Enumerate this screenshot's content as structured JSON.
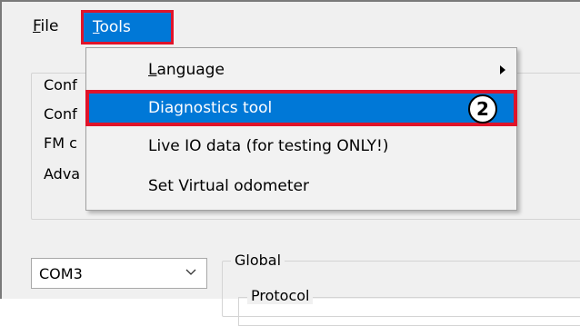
{
  "menubar": {
    "file": {
      "mnemonic": "F",
      "rest": "ile"
    },
    "tools": {
      "mnemonic": "T",
      "rest": "ools"
    }
  },
  "background": {
    "labels": [
      "Conf",
      "Conf",
      "FM c",
      "Adva"
    ],
    "com_port": "COM3",
    "global_label": "Global",
    "protocol_label": "Protocol"
  },
  "tools_menu": {
    "items": [
      {
        "mnemonic": "L",
        "rest": "anguage",
        "has_submenu": true
      },
      {
        "label": "Diagnostics tool",
        "selected": true
      },
      {
        "label": "Live IO data (for testing ONLY!)"
      },
      {
        "label": "Set Virtual odometer"
      }
    ],
    "step_badge": "2"
  },
  "colors": {
    "highlight": "#0078d7",
    "annotation_red": "#e0142a",
    "window_bg": "#f0f0f0"
  },
  "icons": {
    "submenu": "triangle-right-icon",
    "combo": "chevron-down-icon"
  }
}
